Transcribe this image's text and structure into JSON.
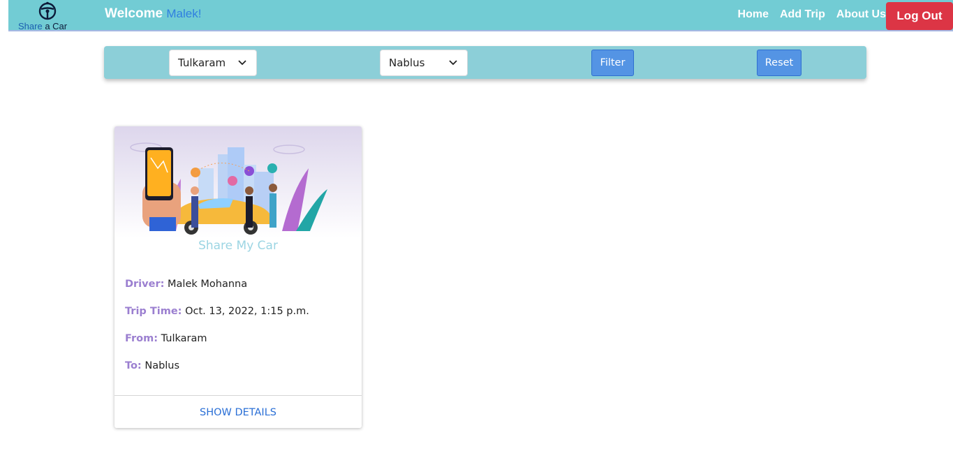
{
  "navbar": {
    "logo": {
      "icon": "steering-wheel-icon",
      "text_part1": "Share",
      "text_part2": "a Car"
    },
    "welcome_label": "Welcome",
    "username": "Malek!",
    "links": {
      "home": "Home",
      "add_trip": "Add Trip",
      "about": "About Us"
    },
    "logout_label": "Log Out",
    "colors": {
      "background": "#72ccd4",
      "logout": "#dc3545"
    }
  },
  "filter": {
    "from_select": "Tulkaram",
    "to_select": "Nablus",
    "filter_label": "Filter",
    "reset_label": "Reset",
    "colors": {
      "bar": "#8ccfd8",
      "button": "#5494e4"
    }
  },
  "trips": [
    {
      "title": "Share My Car",
      "driver_label": "Driver:",
      "driver": "Malek Mohanna",
      "time_label": "Trip Time:",
      "time": "Oct. 13, 2022, 1:15 p.m.",
      "from_label": "From:",
      "from": "Tulkaram",
      "to_label": "To:",
      "to": "Nablus",
      "details_label": "SHOW DETAILS",
      "image_icon": "ride-share-illustration"
    }
  ]
}
